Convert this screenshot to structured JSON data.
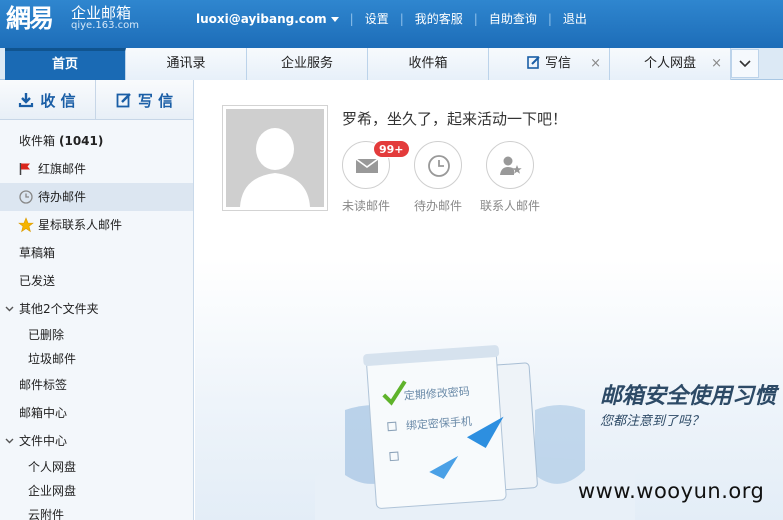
{
  "header": {
    "logo_text": "網易",
    "product_name": "企业邮箱",
    "domain": "qiye.163.com",
    "user_email": "luoxi@ayibang.com",
    "links": [
      "设置",
      "我的客服",
      "自助查询",
      "退出"
    ]
  },
  "tabs": [
    {
      "label": "首页",
      "active": true
    },
    {
      "label": "通讯录"
    },
    {
      "label": "企业服务"
    },
    {
      "label": "收件箱"
    },
    {
      "label": "写信",
      "closable": true,
      "icon": "compose-icon"
    },
    {
      "label": "个人网盘",
      "closable": true
    }
  ],
  "tab_close_glyph": "×",
  "sidebar": {
    "receive_label": "收 信",
    "compose_label": "写 信",
    "items": [
      {
        "label": "收件箱",
        "count": "(1041)"
      },
      {
        "label": "红旗邮件",
        "icon": "red-flag-icon"
      },
      {
        "label": "待办邮件",
        "icon": "clock-icon",
        "selected": true
      },
      {
        "label": "星标联系人邮件",
        "icon": "star-icon"
      },
      {
        "label": "草稿箱"
      },
      {
        "label": "已发送"
      },
      {
        "label": "其他2个文件夹",
        "expandable": true
      },
      {
        "label": "已删除",
        "indent": true
      },
      {
        "label": "垃圾邮件",
        "indent": true
      },
      {
        "label": "邮件标签"
      },
      {
        "label": "邮箱中心"
      },
      {
        "label": "文件中心",
        "expandable": true
      },
      {
        "label": "个人网盘",
        "indent": true
      },
      {
        "label": "企业网盘",
        "indent": true
      },
      {
        "label": "云附件",
        "indent": true
      }
    ]
  },
  "main": {
    "greeting": "罗希，坐久了，起来活动一下吧！",
    "unread_badge": "99+",
    "quick": [
      {
        "label": "未读邮件",
        "icon": "mail-icon"
      },
      {
        "label": "待办邮件",
        "icon": "clock-icon"
      },
      {
        "label": "联系人邮件",
        "icon": "contact-star-icon"
      }
    ],
    "banner": {
      "title": "邮箱安全使用习惯",
      "subtitle": "您都注意到了吗？",
      "note_line1": "定期修改密码",
      "note_line2": "绑定密保手机"
    }
  },
  "watermark": "www.wooyun.org",
  "colors": {
    "header_blue": "#2f86cf",
    "active_tab": "#1a6ab4",
    "badge_red": "#e33b3b",
    "flag_red": "#d9261c",
    "star_gold": "#f5b400"
  }
}
